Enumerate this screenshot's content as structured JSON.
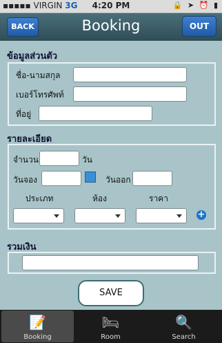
{
  "status": {
    "carrier": "VIRGIN",
    "network": "3G",
    "time": "4:20 PM",
    "icons": "🔒 ➤ ⏰ ▮"
  },
  "nav": {
    "back": "BACK",
    "title": "Booking",
    "out": "OUT"
  },
  "personal": {
    "title": "ข้อมูลส่วนตัว",
    "name_label": "ชื่อ-นามสกุล",
    "phone_label": "เบอร์โทรศัพท์",
    "address_label": "ที่อยู่"
  },
  "details": {
    "title": "รายละเอียด",
    "amount_label": "จำนวน",
    "days_label": "วัน",
    "booking_date_label": "วันจอง",
    "checkout_label": "วันออก",
    "type_label": "ประเภท",
    "room_label": "ห้อง",
    "price_label": "ราคา"
  },
  "total": {
    "title": "รวมเงิน"
  },
  "save_label": "SAVE",
  "tabs": [
    {
      "label": "Booking",
      "icon": "document-edit-icon"
    },
    {
      "label": "Room",
      "icon": "bed-icon"
    },
    {
      "label": "Search",
      "icon": "search-icon"
    }
  ]
}
